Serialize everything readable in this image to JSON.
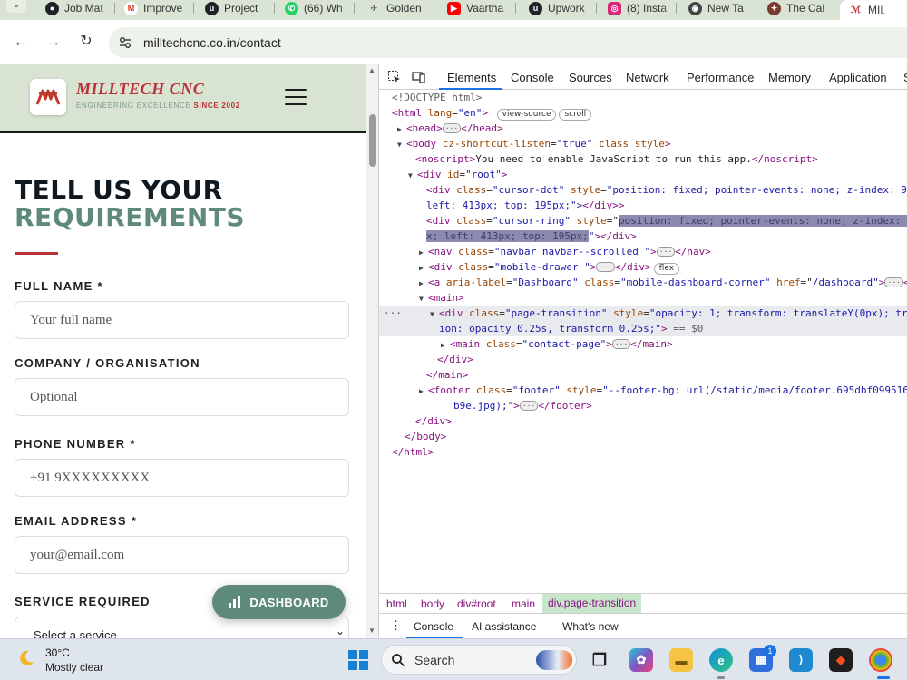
{
  "browser": {
    "tabs": [
      {
        "label": "Job Mat",
        "icon": "github-icon",
        "color": "#1f2328"
      },
      {
        "label": "Improve",
        "icon": "gmail-icon",
        "color": "#d93025"
      },
      {
        "label": "Project",
        "icon": "upwork-icon",
        "color": "#1f2328"
      },
      {
        "label": "(66) Wh",
        "icon": "whatsapp-icon",
        "color": "#25d366"
      },
      {
        "label": "Golden",
        "icon": "pin-icon",
        "color": "#666666"
      },
      {
        "label": "Vaartha",
        "icon": "youtube-icon",
        "color": "#ff0000"
      },
      {
        "label": "Upwork",
        "icon": "upwork-icon",
        "color": "#1f2328"
      },
      {
        "label": "(8) Insta",
        "icon": "instagram-icon",
        "color": "#d62976"
      },
      {
        "label": "New Ta",
        "icon": "chrome-icon",
        "color": "#444444"
      },
      {
        "label": "The Cal",
        "icon": "calendar-icon",
        "color": "#7a3b2e"
      },
      {
        "label": "MIL",
        "icon": "milltech-icon",
        "color": "#b8323a"
      }
    ],
    "url": "milltechcnc.co.in/contact"
  },
  "site": {
    "brand_name": "MILLTECH CNC",
    "tagline_main": "ENGINEERING EXCELLENCE",
    "tagline_highlight": "SINCE 2002",
    "heading_line1": "TELL US YOUR",
    "heading_line2": "REQUIREMENTS",
    "form": {
      "full_name": {
        "label": "FULL NAME *",
        "placeholder": "Your full name"
      },
      "company": {
        "label": "COMPANY / ORGANISATION",
        "placeholder": "Optional"
      },
      "phone": {
        "label": "PHONE NUMBER *",
        "placeholder": "+91 9XXXXXXXXX"
      },
      "email": {
        "label": "EMAIL ADDRESS *",
        "placeholder": "your@email.com"
      },
      "service": {
        "label": "SERVICE REQUIRED",
        "selected": "Select a service"
      }
    },
    "dashboard_button": "DASHBOARD"
  },
  "devtools": {
    "tabs": [
      "Elements",
      "Console",
      "Sources",
      "Network",
      "Performance",
      "Memory",
      "Application",
      "S"
    ],
    "active_tab": "Elements",
    "breadcrumbs": [
      "html",
      "body",
      "div#root",
      "main",
      "div.page-transition"
    ],
    "drawer_tabs": [
      "Console",
      "AI assistance",
      "What's new"
    ],
    "code": {
      "doctype": "<!DOCTYPE html>",
      "html_open": "<html",
      "html_lang_attr": "lang",
      "html_lang_val": "\"en\"",
      "html_close_bracket": ">",
      "badge_view_source": "view-source",
      "badge_scroll": "scroll",
      "head": "<head>",
      "head_close": "</head>",
      "body_open": "<body",
      "body_attr1": "cz-shortcut-listen",
      "body_val1": "\"true\"",
      "body_attr2": "class style",
      "noscript_open": "<noscript>",
      "noscript_text": "You need to enable JavaScript to run this app.",
      "noscript_close": "</noscript>",
      "div_root_open": "<div",
      "div_root_attr": "id",
      "div_root_val": "\"root\"",
      "cursor_dot_class_val": "\"cursor-dot\"",
      "cursor_dot_style_val": "\"position: fixed; pointer-events: none; z-index: 99",
      "cursor_dot_cont": "left: 413px; top: 195px;\">",
      "div_close": "</div>",
      "cursor_ring_class_val": "\"cursor-ring\"",
      "cursor_ring_style_sel": "position: fixed; pointer-events: none; z-index: 9",
      "cursor_ring_cont_sel": "x; left: 413px; top: 195px;",
      "nav_class_val": "\"navbar navbar--scrolled \"",
      "nav_close": "</nav>",
      "mobile_drawer_val": "\"mobile-drawer \"",
      "badge_flex": "flex",
      "a_label_attr": "aria-label",
      "a_label_val": "\"Dashboard\"",
      "a_class_val": "\"mobile-dashboard-corner\"",
      "a_href_attr": "href",
      "a_href_val": "/dashboard",
      "a_close": "</",
      "main_open": "<main>",
      "page_transition_class_val": "\"page-transition\"",
      "page_transition_style_val": "\"opacity: 1; transform: translateY(0px); tra",
      "page_transition_cont": "ion: opacity 0.25s, transform 0.25s;\"",
      "page_transition_eq": "== $0",
      "contact_page_class_val": "\"contact-page\"",
      "main_close": "</main>",
      "footer_class_val": "\"footer\"",
      "footer_style_val": "\"--footer-bg: url(/static/media/footer.695dbf099516c",
      "footer_cont": "b9e.jpg);\"",
      "footer_close": "</footer>",
      "body_close": "</body>",
      "html_close": "</html>",
      "gt": ">",
      "class_attr": "class",
      "style_attr": "style",
      "div_tag": "<div",
      "nav_tag": "<nav",
      "a_tag": "<a",
      "main_tag": "<main",
      "footer_tag": "<footer"
    }
  },
  "taskbar": {
    "temperature": "30°C",
    "weather": "Mostly clear",
    "search": "Search",
    "store_badge": "1"
  }
}
